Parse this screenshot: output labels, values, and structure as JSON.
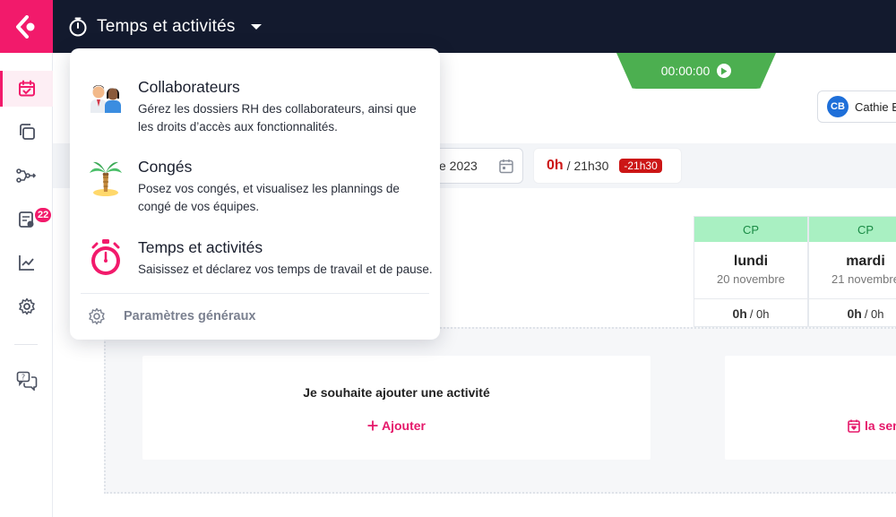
{
  "topbar": {
    "module_title": "Temps et activités",
    "colors": {
      "bar": "#131a2e",
      "brand": "#f21a6b"
    }
  },
  "sidebar": {
    "items": [
      {
        "name": "calendar-check",
        "active": true
      },
      {
        "name": "copy"
      },
      {
        "name": "workflow"
      },
      {
        "name": "requests",
        "badge": "22"
      },
      {
        "name": "analytics"
      },
      {
        "name": "settings"
      },
      {
        "name": "support-chat"
      }
    ]
  },
  "header": {
    "timer": "00:00:00",
    "user_initials": "CB",
    "user_name": "Cathie B"
  },
  "filters": {
    "date_text": "e 2023",
    "worked": "0h",
    "planned": "/ 21h30",
    "difference": "-21h30"
  },
  "days": [
    {
      "tag": "CP",
      "name": "lundi",
      "date": "20 novembre",
      "worked": "0h",
      "planned": "/ 0h"
    },
    {
      "tag": "CP",
      "name": "mardi",
      "date": "21 novembre",
      "worked": "0h",
      "planned": "/ 0h"
    }
  ],
  "activities": {
    "prompt": "Je souhaite ajouter une activité",
    "add_label": "Ajouter",
    "week_label": "la sem"
  },
  "dropdown": {
    "items": [
      {
        "title": "Collaborateurs",
        "desc": "Gérez les dossiers RH des collaborateurs, ainsi que les droits d’accès aux fonctionnalités."
      },
      {
        "title": "Congés",
        "desc": "Posez vos congés, et visualisez les plannings de congé de vos équipes."
      },
      {
        "title": "Temps et activités",
        "desc": "Saisissez et déclarez vos temps de travail et de pause."
      }
    ],
    "settings_label": "Paramètres généraux"
  }
}
